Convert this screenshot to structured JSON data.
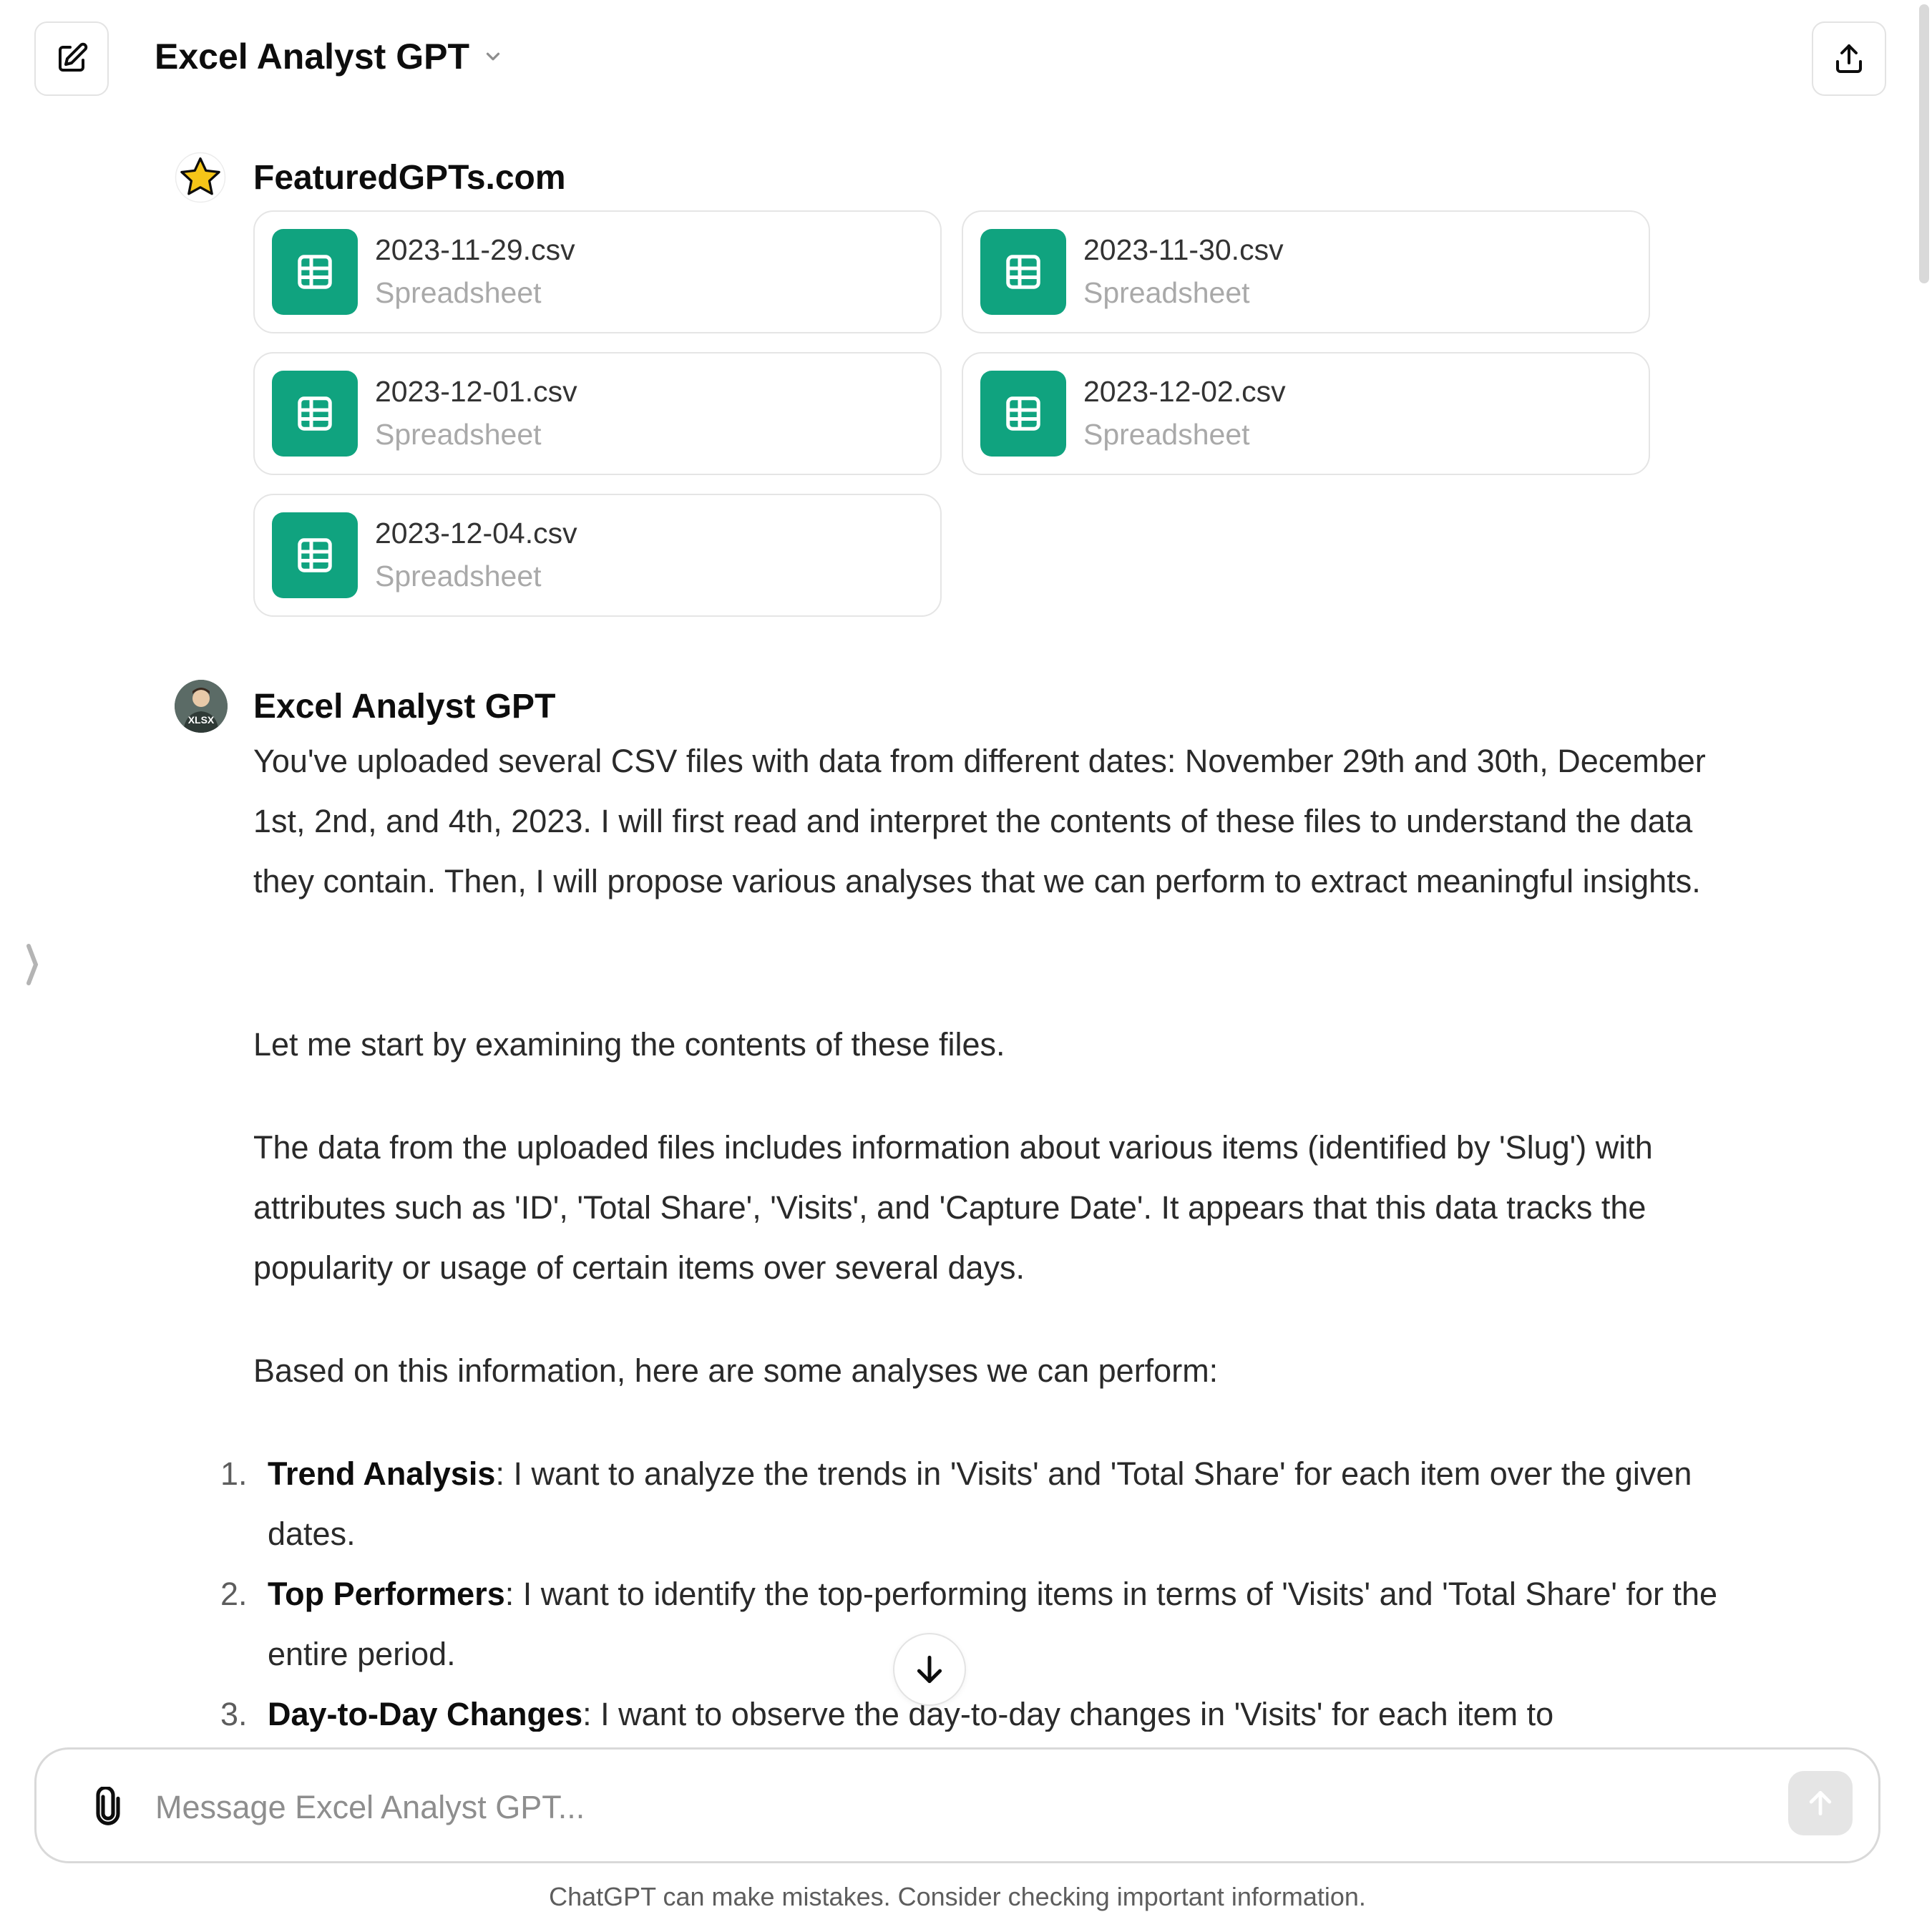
{
  "header": {
    "title": "Excel Analyst GPT",
    "new_chat_icon": "edit-icon",
    "share_icon": "share-icon",
    "dropdown_icon": "chevron-down-icon"
  },
  "user_message": {
    "author": "FeaturedGPTs.com",
    "avatar_icon": "star-icon",
    "files": [
      {
        "name": "2023-11-29.csv",
        "type": "Spreadsheet"
      },
      {
        "name": "2023-11-30.csv",
        "type": "Spreadsheet"
      },
      {
        "name": "2023-12-01.csv",
        "type": "Spreadsheet"
      },
      {
        "name": "2023-12-02.csv",
        "type": "Spreadsheet"
      },
      {
        "name": "2023-12-04.csv",
        "type": "Spreadsheet"
      }
    ]
  },
  "assistant_message": {
    "author": "Excel Analyst GPT",
    "avatar_label": "XLSX",
    "paragraphs": [
      "You've uploaded several CSV files with data from different dates: November 29th and 30th, December 1st, 2nd, and 4th, 2023. I will first read and interpret the contents of these files to understand the data they contain. Then, I will propose various analyses that we can perform to extract meaningful insights.",
      "Let me start by examining the contents of these files.",
      "The data from the uploaded files includes information about various items (identified by 'Slug') with attributes such as 'ID', 'Total Share', 'Visits', and 'Capture Date'. It appears that this data tracks the popularity or usage of certain items over several days.",
      "Based on this information, here are some analyses we can perform:"
    ],
    "list": [
      {
        "num": "1.",
        "title": "Trend Analysis",
        "text": ": I want to analyze the trends in 'Visits' and 'Total Share' for each item over the given dates."
      },
      {
        "num": "2.",
        "title": "Top Performers",
        "text": ": I want to identify the top-performing items in terms of 'Visits' and 'Total Share' for the entire period."
      },
      {
        "num": "3.",
        "title": "Day-to-Day Changes",
        "text": ": I want to observe the day-to-day changes in 'Visits' for each item to"
      }
    ]
  },
  "composer": {
    "placeholder": "Message Excel Analyst GPT...",
    "value": "",
    "attach_icon": "paperclip-icon",
    "send_icon": "arrow-up-icon"
  },
  "scroll_down_icon": "arrow-down-icon",
  "footer_note": "ChatGPT can make mistakes. Consider checking important information.",
  "colors": {
    "spreadsheet_green": "#10a37f",
    "star_yellow": "#f5c518"
  }
}
